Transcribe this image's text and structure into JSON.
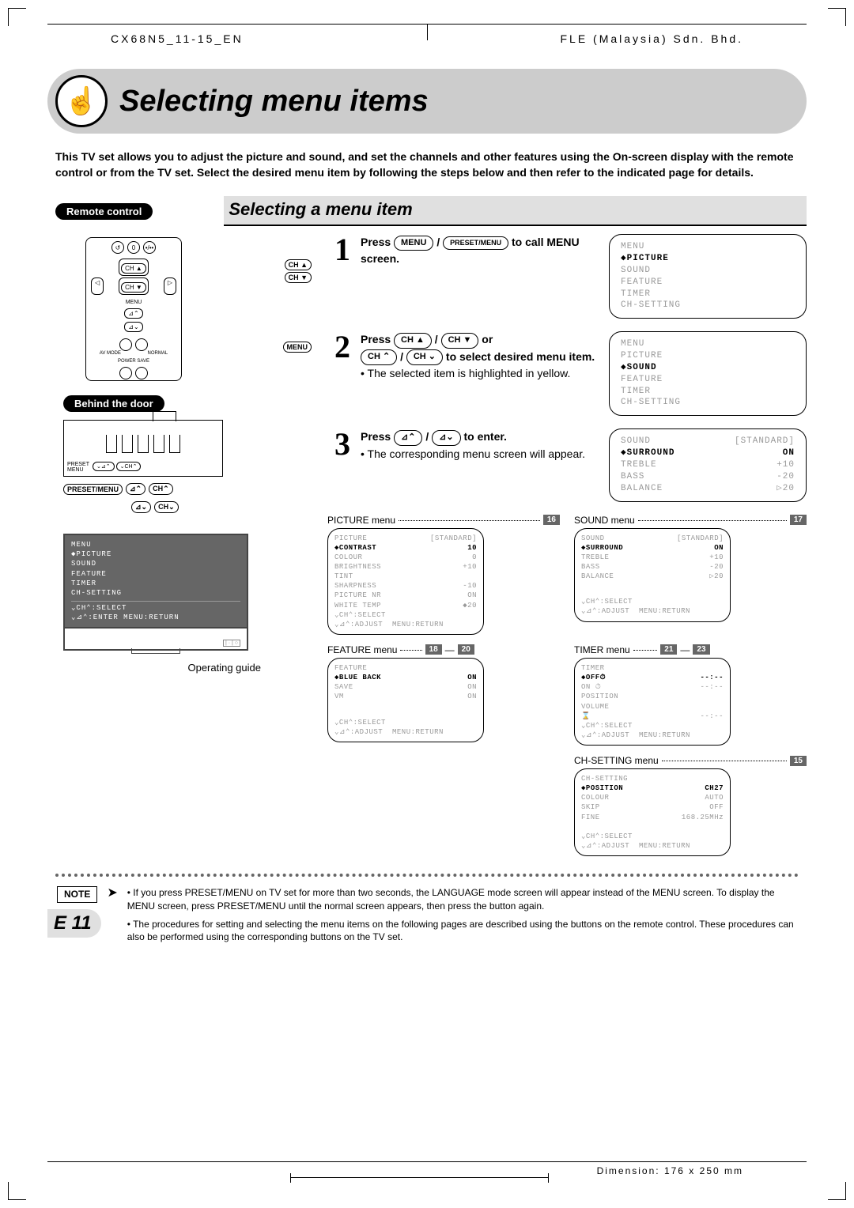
{
  "header": {
    "doc_code": "CX68N5_11-15_EN",
    "company": "FLE (Malaysia) Sdn. Bhd."
  },
  "title": "Selecting menu items",
  "intro": "This TV set allows you to adjust the picture and sound, and set the channels and other features using the On-screen display with the remote control or from the TV set. Select the desired menu item by following the steps below and then refer to the indicated page for details.",
  "pill_remote": "Remote control",
  "pill_behind": "Behind the door",
  "subtitle": "Selecting a menu item",
  "remote_labels": {
    "ch_up": "CH ▲",
    "ch_down": "CH ▼",
    "menu": "MENU",
    "zero": "0",
    "av": "AV MODE",
    "normal": "NORMAL",
    "power": "POWER SAVE"
  },
  "panel": {
    "preset_menu": "PRESET/MENU",
    "ch_up": "CH",
    "ch_down": "CH"
  },
  "steps": [
    {
      "side": [
        "CH ▲",
        "CH ▼"
      ],
      "num": "1",
      "pre": "Press ",
      "btn1": "MENU",
      "mid": " / ",
      "btn2": "PRESET/MENU",
      "post": " to call MENU screen.",
      "sub": ""
    },
    {
      "side": [
        "MENU"
      ],
      "num": "2",
      "pre": "Press ",
      "btn1": "CH ▲",
      "mid": " / ",
      "btn2": "CH ▼",
      "post": " or ",
      "btn3": "CH ⌃",
      "btn4": "CH ⌄",
      "post2": " to select desired menu item.",
      "sub": "• The selected item is highlighted in yellow."
    },
    {
      "side": [],
      "num": "3",
      "pre": "Press ",
      "btn1": "⊿⌃",
      "mid": " / ",
      "btn2": "⊿⌄",
      "post": " to enter.",
      "sub": "• The corresponding menu screen will appear."
    }
  ],
  "osd1": {
    "title": "MENU",
    "items": [
      "◆PICTURE",
      "  SOUND",
      "  FEATURE",
      "  TIMER",
      "  CH-SETTING"
    ],
    "sel": 0
  },
  "osd2": {
    "title": "MENU",
    "items": [
      "  PICTURE",
      "◆SOUND",
      "  FEATURE",
      "  TIMER",
      "  CH-SETTING"
    ],
    "sel": 1
  },
  "osd3": {
    "title_l": "SOUND",
    "title_r": "[STANDARD]",
    "rows": [
      [
        "◆SURROUND",
        "ON"
      ],
      [
        "TREBLE",
        "+10"
      ],
      [
        "BASS",
        "-20"
      ],
      [
        "BALANCE",
        "▷20"
      ]
    ]
  },
  "tv_osd": {
    "title": "MENU",
    "items": [
      "◆PICTURE",
      " SOUND",
      " FEATURE",
      " TIMER",
      " CH-SETTING"
    ],
    "foot1": "⌄CH⌃:SELECT",
    "foot2": "⌄⊿⌃:ENTER   MENU:RETURN"
  },
  "op_guide": "Operating guide",
  "menus": {
    "picture": {
      "caption": "PICTURE menu",
      "page": "16",
      "title_l": "PICTURE",
      "title_r": "[STANDARD]",
      "rows": [
        [
          "◆CONTRAST",
          "10"
        ],
        [
          " COLOUR",
          "0"
        ],
        [
          " BRIGHTNESS",
          "+10"
        ],
        [
          " TINT",
          ""
        ],
        [
          " SHARPNESS",
          "-10"
        ],
        [
          " PICTURE NR",
          "ON"
        ],
        [
          " WHITE TEMP",
          "◆20"
        ]
      ],
      "foot": "⌄CH⌃:SELECT\n⌄⊿⌃:ADJUST  MENU:RETURN"
    },
    "sound": {
      "caption": "SOUND menu",
      "page": "17",
      "title_l": "SOUND",
      "title_r": "[STANDARD]",
      "rows": [
        [
          "◆SURROUND",
          "ON"
        ],
        [
          " TREBLE",
          "+10"
        ],
        [
          " BASS",
          "-20"
        ],
        [
          " BALANCE",
          "▷20"
        ]
      ],
      "foot": "⌄CH⌃:SELECT\n⌄⊿⌃:ADJUST  MENU:RETURN"
    },
    "feature": {
      "caption": "FEATURE menu",
      "page": "18",
      "page2": "20",
      "title_l": "FEATURE",
      "title_r": "",
      "rows": [
        [
          "◆BLUE BACK",
          "ON"
        ],
        [
          " SAVE",
          "ON"
        ],
        [
          " VM",
          "ON"
        ]
      ],
      "foot": "⌄CH⌃:SELECT\n⌄⊿⌃:ADJUST  MENU:RETURN"
    },
    "timer": {
      "caption": "TIMER menu",
      "page": "21",
      "page2": "23",
      "title_l": "TIMER",
      "title_r": "",
      "rows": [
        [
          "◆OFF⏱",
          "--:--"
        ],
        [
          " ON ⏱",
          "--:--"
        ],
        [
          "  POSITION",
          ""
        ],
        [
          "  VOLUME",
          ""
        ],
        [
          " ⌛",
          "--:--"
        ]
      ],
      "foot": "⌄CH⌃:SELECT\n⌄⊿⌃:ADJUST  MENU:RETURN"
    },
    "chsetting": {
      "caption": "CH-SETTING menu",
      "page": "15",
      "title_l": "CH-SETTING",
      "title_r": "",
      "rows": [
        [
          "◆POSITION",
          "CH27"
        ],
        [
          " COLOUR",
          "AUTO"
        ],
        [
          " SKIP",
          "OFF"
        ],
        [
          " FINE",
          "168.25MHz"
        ]
      ],
      "foot": "⌄CH⌃:SELECT\n⌄⊿⌃:ADJUST  MENU:RETURN"
    }
  },
  "note_label": "NOTE",
  "notes": [
    "If you press PRESET/MENU on TV set for more than two seconds, the LANGUAGE mode screen will appear instead of the MENU screen. To display the MENU screen, press PRESET/MENU until the normal screen appears, then press the button again.",
    "The procedures for setting and selecting the menu items on the following pages are described using the buttons on the remote control. These procedures can also be performed using the corresponding buttons on the TV set."
  ],
  "pagenum": "E 11",
  "dimension": "Dimension: 176 x 250 mm"
}
